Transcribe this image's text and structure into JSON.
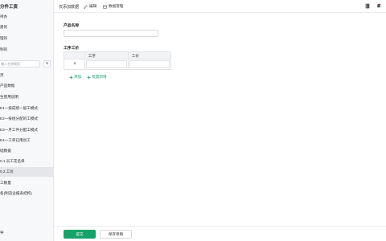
{
  "sidebar": {
    "title": "分件工资",
    "search_placeholder": "输入名称搜索",
    "items": [
      {
        "label": "待办"
      },
      {
        "label": "建的"
      },
      {
        "label": "理的"
      },
      {
        "label": "制的"
      },
      {
        "label": "页"
      },
      {
        "label": "产品数据"
      },
      {
        "label": "生使用说明"
      },
      {
        "label": "E1一按成绩一般工模式"
      },
      {
        "label": "E2一按组分配的工模式"
      },
      {
        "label": "E3一月工件分配工模式"
      },
      {
        "label": "E4一工单已用创工"
      },
      {
        "label": "础数据"
      },
      {
        "label": "0.1 员工花名单"
      },
      {
        "label": "0.2 工价"
      },
      {
        "label": "工数量"
      },
      {
        "label": "各(制造业报表结构)"
      }
    ],
    "footer": "导"
  },
  "topbar": {
    "doc_title": "仅添加数据",
    "edit_label": "编辑",
    "data_manage_label": "数据管理"
  },
  "form": {
    "product_label": "产品名称",
    "product_value": "",
    "process_label": "工序工价",
    "columns": [
      "工序",
      "工价"
    ],
    "row_add_symbol": "+",
    "add_label": "添加",
    "batch_add_label": "批量新增"
  },
  "footer": {
    "submit_label": "提交",
    "save_draft_label": "保存草稿"
  },
  "colors": {
    "accent": "#15a36a",
    "sidebar_bg": "#f7f8fa",
    "active_item": "#e4e6ea"
  }
}
